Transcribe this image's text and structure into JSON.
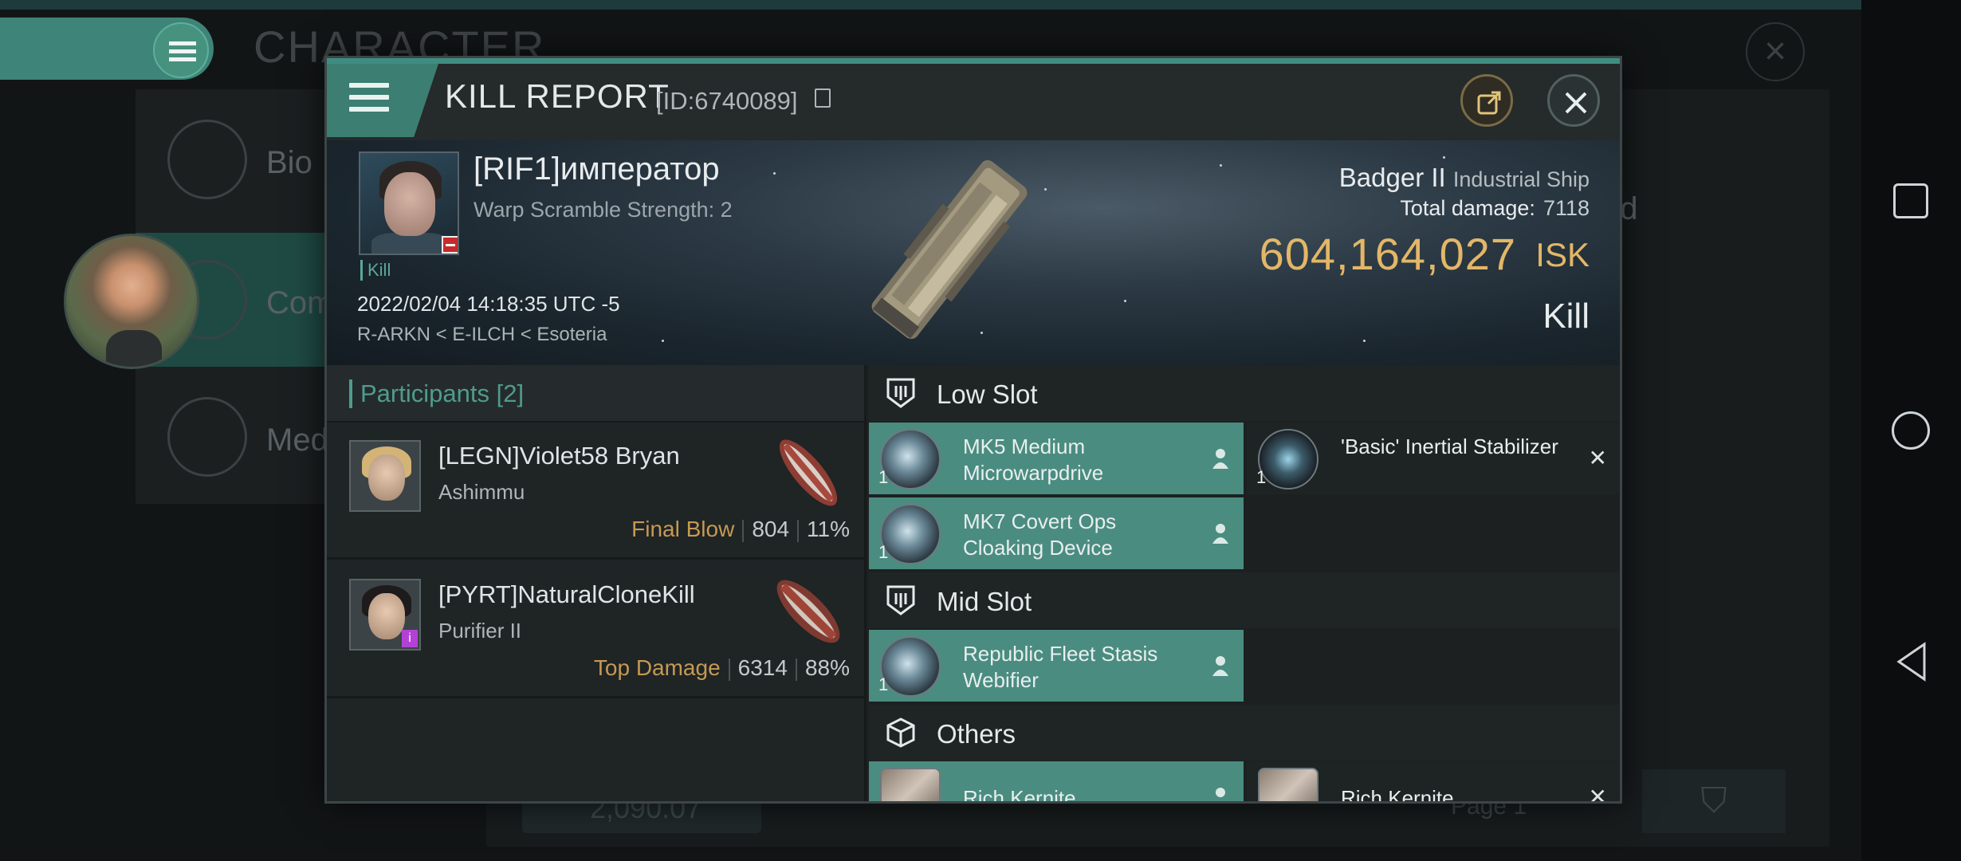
{
  "background": {
    "title": "CHARACTER",
    "side_items": [
      "Bio",
      "Com",
      "Med"
    ],
    "partial_text": "ed",
    "field_value": "2,090.07",
    "page_label": "Page 1"
  },
  "dialog": {
    "title": "KILL REPORT",
    "id_text": "[ID:6740089]"
  },
  "victim": {
    "name": "[RIF1]император",
    "warp": "Warp Scramble Strength: 2",
    "kill_tag": "Kill",
    "datetime": "2022/02/04 14:18:35 UTC -5",
    "location": "R-ARKN < E-ILCH < Esoteria",
    "ship_name": "Badger II",
    "ship_class": "Industrial Ship",
    "damage_label": "Total damage:",
    "damage_value": "7118",
    "isk_value": "604,164,027",
    "isk_unit": "ISK",
    "result": "Kill"
  },
  "participants": {
    "title": "Participants",
    "count": "[2]",
    "rows": [
      {
        "name": "[LEGN]Violet58 Bryan",
        "ship": "Ashimmu",
        "label": "Final Blow",
        "damage": "804",
        "percent": "11%"
      },
      {
        "name": "[PYRT]NaturalCloneKill",
        "ship": "Purifier II",
        "label": "Top Damage",
        "damage": "6314",
        "percent": "88%"
      }
    ]
  },
  "slots": {
    "low": {
      "title": "Low Slot",
      "items": [
        {
          "name": "MK5 Medium Microwarpdrive",
          "qty": "1"
        },
        {
          "name": "'Basic' Inertial Stabilizer",
          "qty": "1"
        },
        {
          "name": "MK7 Covert Ops Cloaking Device",
          "qty": "1"
        }
      ]
    },
    "mid": {
      "title": "Mid Slot",
      "items": [
        {
          "name": "Republic Fleet Stasis Webifier",
          "qty": "1"
        }
      ]
    },
    "others": {
      "title": "Others",
      "items": [
        {
          "name": "Rich Kernite"
        },
        {
          "name": "Rich Kernite"
        }
      ]
    }
  },
  "colors": {
    "accent": "#4a8c80",
    "isk": "#e3b768",
    "final_blow": "#c59a52"
  }
}
